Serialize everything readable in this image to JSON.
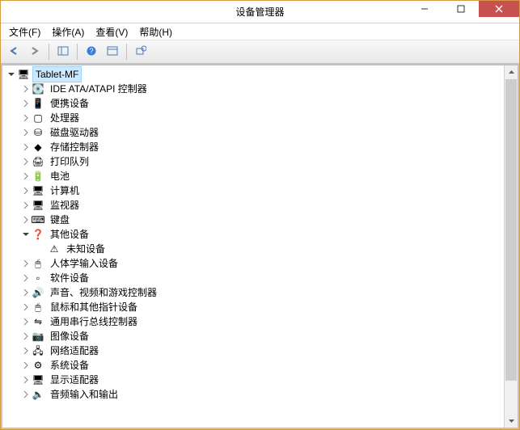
{
  "title": "设备管理器",
  "menu": {
    "file": "文件(F)",
    "action": "操作(A)",
    "view": "查看(V)",
    "help": "帮助(H)"
  },
  "root": {
    "label": "Tablet-MF"
  },
  "categories": [
    {
      "label": "IDE ATA/ATAPI 控制器",
      "icon": "ide"
    },
    {
      "label": "便携设备",
      "icon": "portable"
    },
    {
      "label": "处理器",
      "icon": "cpu"
    },
    {
      "label": "磁盘驱动器",
      "icon": "disk"
    },
    {
      "label": "存储控制器",
      "icon": "storage"
    },
    {
      "label": "打印队列",
      "icon": "printer"
    },
    {
      "label": "电池",
      "icon": "battery"
    },
    {
      "label": "计算机",
      "icon": "computer"
    },
    {
      "label": "监视器",
      "icon": "monitor"
    },
    {
      "label": "键盘",
      "icon": "keyboard"
    },
    {
      "label": "其他设备",
      "icon": "other",
      "expanded": true,
      "children": [
        {
          "label": "未知设备",
          "icon": "unknown"
        }
      ]
    },
    {
      "label": "人体学输入设备",
      "icon": "hid"
    },
    {
      "label": "软件设备",
      "icon": "software"
    },
    {
      "label": "声音、视频和游戏控制器",
      "icon": "sound"
    },
    {
      "label": "鼠标和其他指针设备",
      "icon": "mouse"
    },
    {
      "label": "通用串行总线控制器",
      "icon": "usb"
    },
    {
      "label": "图像设备",
      "icon": "camera"
    },
    {
      "label": "网络适配器",
      "icon": "network"
    },
    {
      "label": "系统设备",
      "icon": "system"
    },
    {
      "label": "显示适配器",
      "icon": "display"
    },
    {
      "label": "音频输入和输出",
      "icon": "audio"
    }
  ],
  "icons": {
    "ide": "💽",
    "portable": "📱",
    "cpu": "▢",
    "disk": "⛁",
    "storage": "◆",
    "printer": "🖨",
    "battery": "🔋",
    "computer": "🖥",
    "monitor": "🖥",
    "keyboard": "⌨",
    "other": "❓",
    "unknown": "⚠",
    "hid": "🖱",
    "software": "▫",
    "sound": "🔊",
    "mouse": "🖱",
    "usb": "⇋",
    "camera": "📷",
    "network": "🖧",
    "system": "⚙",
    "display": "🖥",
    "audio": "🔈",
    "root": "🖥"
  }
}
